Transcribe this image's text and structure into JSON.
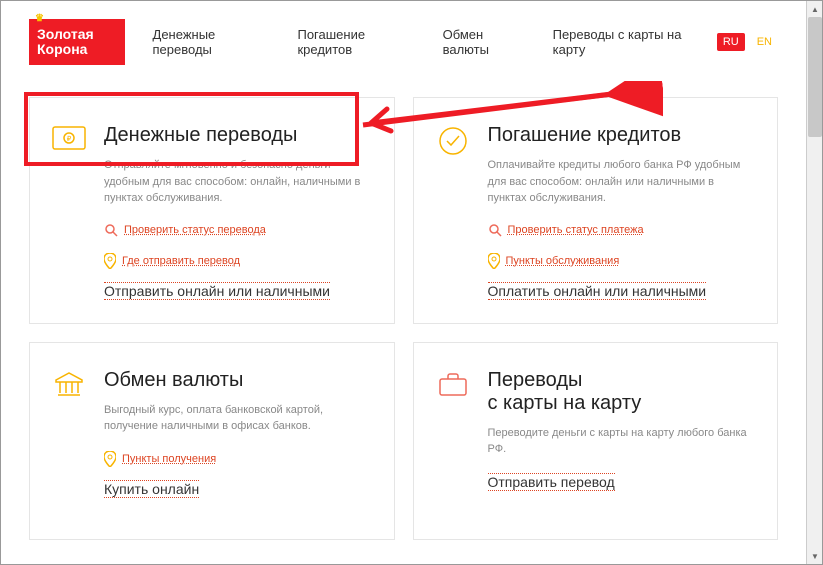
{
  "logo": {
    "line1": "Золотая",
    "line2": "Корона"
  },
  "nav": {
    "transfers": "Денежные переводы",
    "loans": "Погашение кредитов",
    "exchange": "Обмен валюты",
    "card2card": "Переводы с карты на карту"
  },
  "lang": {
    "ru": "RU",
    "en": "EN"
  },
  "cards": {
    "transfers": {
      "title": "Денежные переводы",
      "desc": "Отправляйте мгновенно и безопасно деньги удобным для вас способом: онлайн, наличными в пунктах обслуживания.",
      "link1": "Проверить статус перевода",
      "link2": "Где отправить перевод",
      "cta": "Отправить онлайн или наличными"
    },
    "loans": {
      "title": "Погашение кредитов",
      "desc": "Оплачивайте кредиты любого банка РФ удобным для вас способом: онлайн или наличными в пунктах обслуживания.",
      "link1": "Проверить статус платежа",
      "link2": "Пункты обслуживания",
      "cta": "Оплатить онлайн или наличными"
    },
    "exchange": {
      "title": "Обмен валюты",
      "desc": "Выгодный курс, оплата банковской картой, получение наличными в офисах банков.",
      "link1": "Пункты получения",
      "cta": "Купить онлайн"
    },
    "card2card": {
      "title_line1": "Переводы",
      "title_line2": "с карты на карту",
      "desc": "Переводите деньги с карты на карту любого банка РФ.",
      "cta": "Отправить перевод"
    }
  }
}
